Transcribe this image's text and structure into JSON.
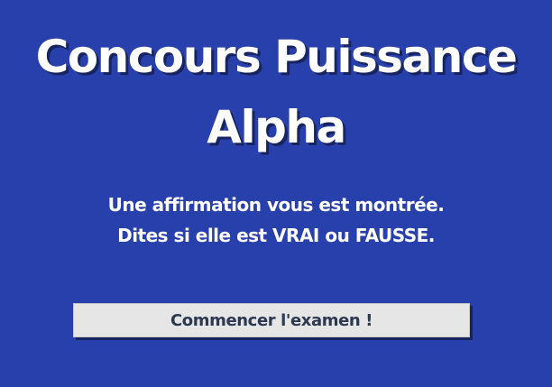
{
  "screen": {
    "title_line_1": "Concours Puissance",
    "title_line_2": "Alpha",
    "instruction_line_1": "Une affirmation vous est montrée.",
    "instruction_line_2": "Dites si elle est VRAI ou FAUSSE.",
    "start_button_label": "Commencer l'examen !"
  },
  "colors": {
    "background": "#2840ab",
    "text": "#ffffff",
    "button_background": "#e6e6e6",
    "button_text": "#2d3950",
    "shadow": "#17245f"
  }
}
